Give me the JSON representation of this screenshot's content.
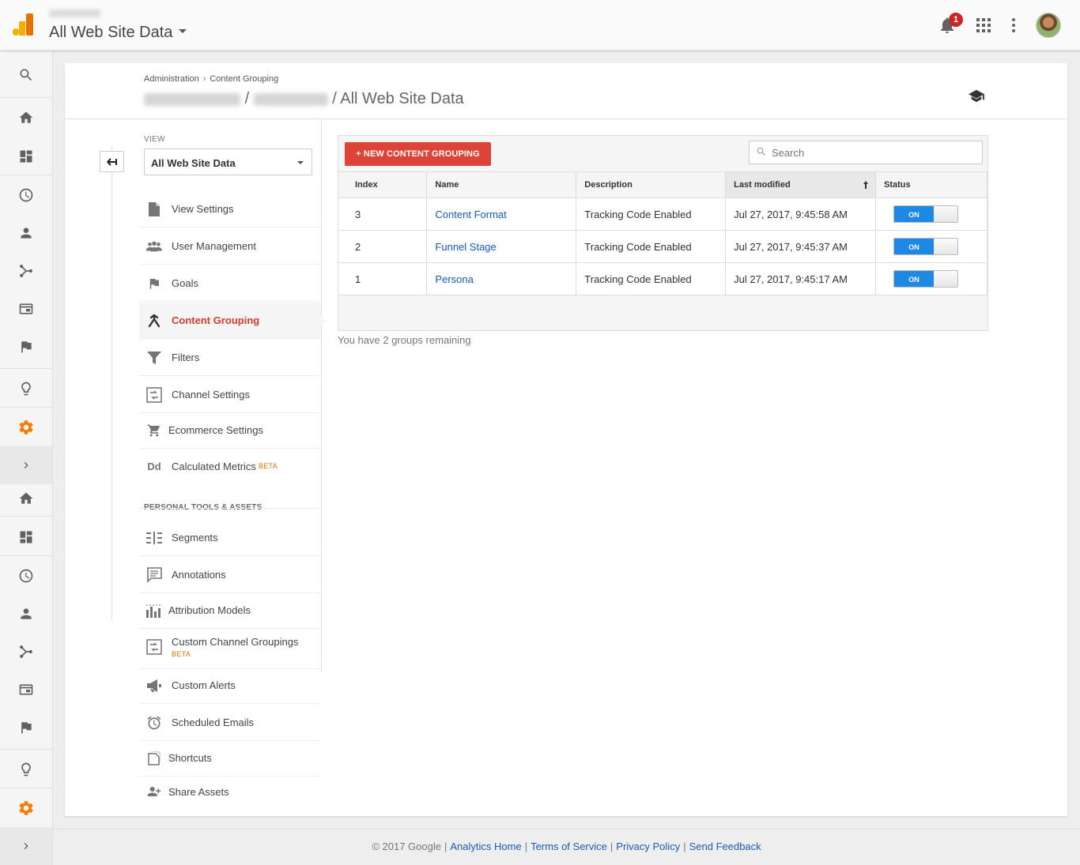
{
  "header": {
    "property_title": "All Web Site Data",
    "notification_count": "1"
  },
  "breadcrumb": {
    "items": [
      "Administration",
      "Content Grouping"
    ],
    "separator": "›"
  },
  "page_path": {
    "separator": "/",
    "view": "All Web Site Data"
  },
  "view_selector": {
    "label": "VIEW",
    "selected": "All Web Site Data"
  },
  "nav": {
    "items": [
      {
        "label": "View Settings",
        "icon": "document-icon"
      },
      {
        "label": "User Management",
        "icon": "people-icon"
      },
      {
        "label": "Goals",
        "icon": "flag-icon"
      },
      {
        "label": "Content Grouping",
        "icon": "content-grouping-icon",
        "active": true
      },
      {
        "label": "Filters",
        "icon": "filter-icon"
      },
      {
        "label": "Channel Settings",
        "icon": "channel-settings-icon"
      },
      {
        "label": "Ecommerce Settings",
        "icon": "cart-icon"
      },
      {
        "label": "Calculated Metrics",
        "icon": "dd-icon",
        "badge": "BETA"
      }
    ],
    "section_label": "PERSONAL TOOLS & ASSETS",
    "personal_items": [
      {
        "label": "Segments",
        "icon": "segments-icon"
      },
      {
        "label": "Annotations",
        "icon": "annotation-icon"
      },
      {
        "label": "Attribution Models",
        "icon": "attribution-icon"
      },
      {
        "label": "Custom Channel Groupings",
        "icon": "channel-grouping-icon",
        "badge": "BETA"
      },
      {
        "label": "Custom Alerts",
        "icon": "megaphone-icon"
      },
      {
        "label": "Scheduled Emails",
        "icon": "alarm-clock-icon"
      },
      {
        "label": "Shortcuts",
        "icon": "shortcut-icon"
      },
      {
        "label": "Share Assets",
        "icon": "add-person-icon"
      }
    ]
  },
  "toolbar": {
    "new_button": "+ NEW CONTENT GROUPING",
    "search_placeholder": "Search"
  },
  "table": {
    "columns": [
      "Index",
      "Name",
      "Description",
      "Last modified",
      "Status"
    ],
    "sorted_column": "Last modified",
    "rows": [
      {
        "index": "3",
        "name": "Content Format",
        "description": "Tracking Code Enabled",
        "modified": "Jul 27, 2017, 9:45:58 AM",
        "status": "ON"
      },
      {
        "index": "2",
        "name": "Funnel Stage",
        "description": "Tracking Code Enabled",
        "modified": "Jul 27, 2017, 9:45:37 AM",
        "status": "ON"
      },
      {
        "index": "1",
        "name": "Persona",
        "description": "Tracking Code Enabled",
        "modified": "Jul 27, 2017, 9:45:17 AM",
        "status": "ON"
      }
    ],
    "remaining_text": "You have 2 groups remaining"
  },
  "footer": {
    "copyright": "© 2017 Google",
    "links": [
      "Analytics Home",
      "Terms of Service",
      "Privacy Policy",
      "Send Feedback"
    ]
  },
  "colors": {
    "accent_red": "#db4437",
    "toggle_blue": "#1e88e5",
    "link_blue": "#1a5bb5",
    "settings_orange": "#f57c00"
  }
}
